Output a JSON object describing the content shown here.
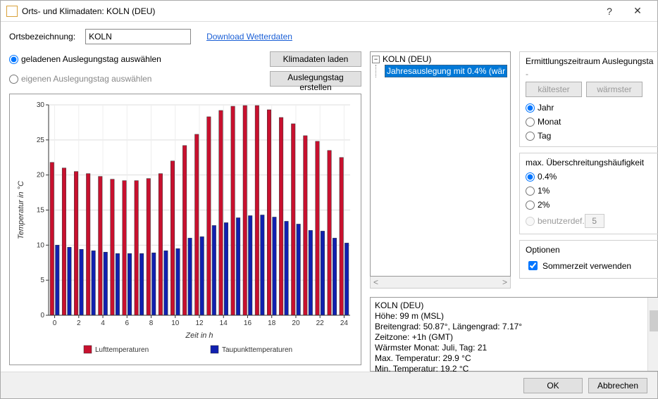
{
  "window": {
    "title": "Orts- und Klimadaten: KOLN (DEU)",
    "help": "?",
    "close": "✕"
  },
  "top": {
    "label": "Ortsbezeichnung:",
    "value": "KOLN",
    "download_link": "Download Wetterdaten"
  },
  "left_controls": {
    "radio_loaded": "geladenen Auslegungstag auswählen",
    "radio_own": "eigenen Auslegungstag auswählen",
    "btn_load": "Klimadaten laden",
    "btn_create": "Auslegungstag erstellen"
  },
  "tree": {
    "root": "KOLN (DEU)",
    "selected": "Jahresauslegung mit 0.4% (wär"
  },
  "period_group": {
    "title": "Ermittlungszeitraum Auslegungsta",
    "btn_cold": "kältester",
    "btn_warm": "wärmster",
    "year": "Jahr",
    "month": "Monat",
    "day": "Tag"
  },
  "freq_group": {
    "title": "max. Überschreitungshäufigkeit",
    "p04": "0.4%",
    "p1": "1%",
    "p2": "2%",
    "user": "benutzerdef.",
    "user_val": "5"
  },
  "options_group": {
    "title": "Optionen",
    "dst": "Sommerzeit verwenden"
  },
  "info": {
    "l1": "KOLN  (DEU)",
    "l2": "Höhe: 99 m (MSL)",
    "l3": "Breitengrad: 50.87°, Längengrad: 7.17°",
    "l4": "Zeitzone: +1h (GMT)",
    "l5": "",
    "l6": "Wärmster Monat: Juli, Tag: 21",
    "l7": "Max. Temperatur: 29.9 °C",
    "l8": "Min. Temperatur: 19.2 °C"
  },
  "footer": {
    "ok": "OK",
    "cancel": "Abbrechen"
  },
  "chart_data": {
    "type": "bar",
    "xlabel": "Zeit in h",
    "ylabel": "Temperatur in °C",
    "ylim": [
      0,
      30
    ],
    "categories": [
      0,
      1,
      2,
      3,
      4,
      5,
      6,
      7,
      8,
      9,
      10,
      11,
      12,
      13,
      14,
      15,
      16,
      17,
      18,
      19,
      20,
      21,
      22,
      23,
      24
    ],
    "series": [
      {
        "name": "Lufttemperaturen",
        "color": "#c8102e",
        "values": [
          21.8,
          21.0,
          20.5,
          20.2,
          19.8,
          19.4,
          19.2,
          19.2,
          19.5,
          20.2,
          22.0,
          24.2,
          25.8,
          28.3,
          29.2,
          29.8,
          29.9,
          29.9,
          29.3,
          28.2,
          27.3,
          25.6,
          24.8,
          23.5,
          22.5
        ]
      },
      {
        "name": "Taupunkttemperaturen",
        "color": "#1020b0",
        "values": [
          10.0,
          9.7,
          9.4,
          9.2,
          9.0,
          8.8,
          8.8,
          8.8,
          8.9,
          9.2,
          9.5,
          11.0,
          11.2,
          12.8,
          13.2,
          13.9,
          14.2,
          14.3,
          14.0,
          13.4,
          13.0,
          12.1,
          12.0,
          11.0,
          10.3
        ]
      }
    ]
  }
}
